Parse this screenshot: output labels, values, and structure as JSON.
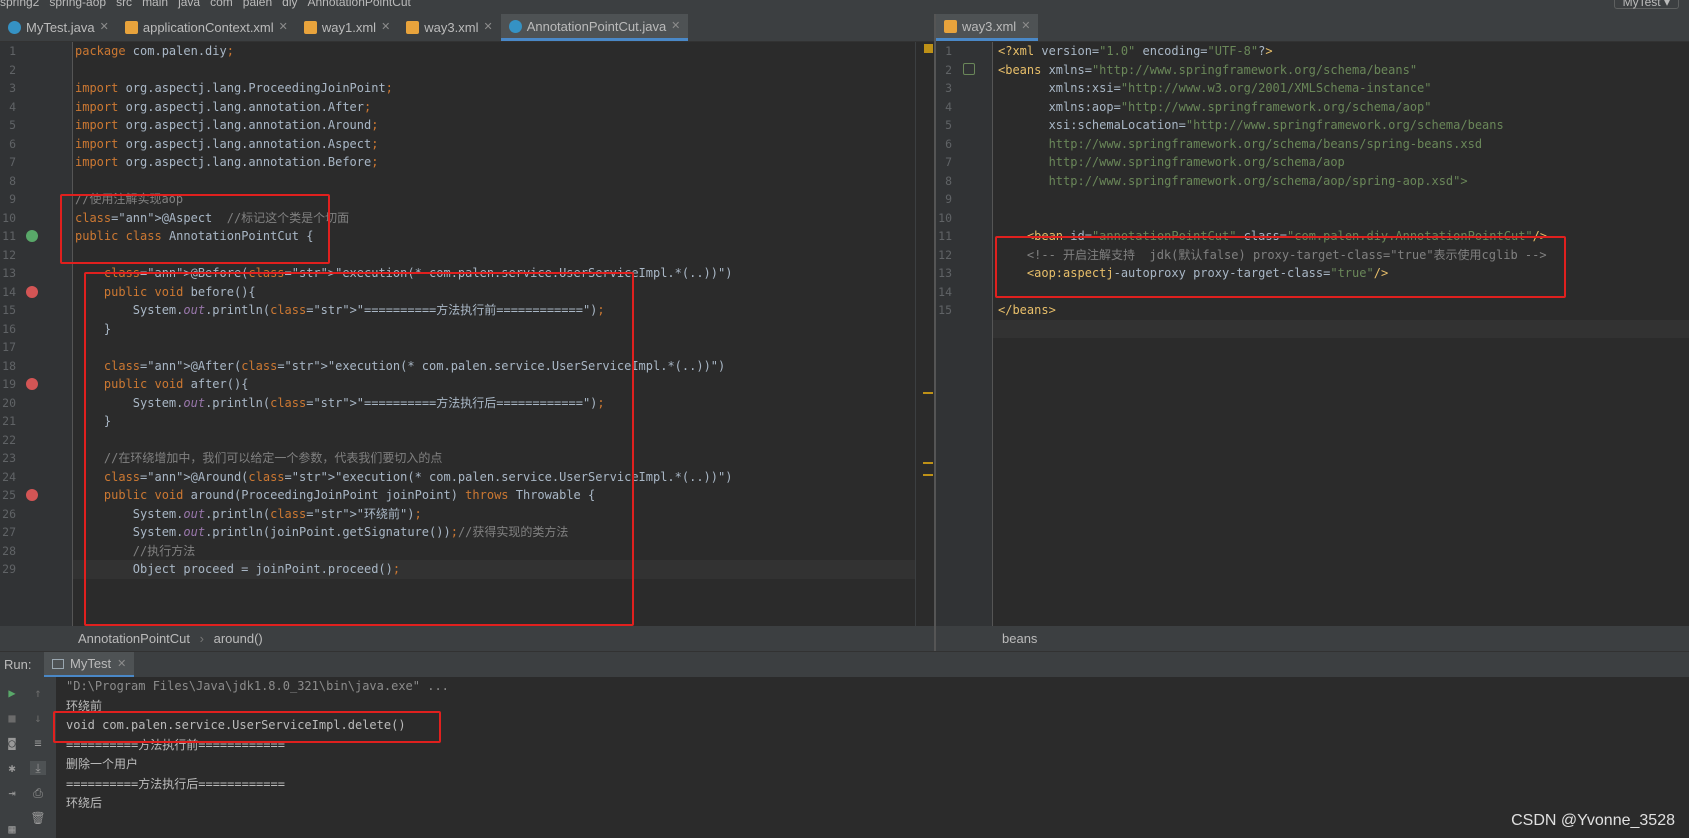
{
  "topbar": {
    "breadcrumb": [
      "spring2",
      "spring-aop",
      "src",
      "main",
      "java",
      "com",
      "palen",
      "diy",
      "AnnotationPointCut"
    ],
    "run_config": "MyTest"
  },
  "left_tabs": [
    {
      "label": "MyTest.java",
      "icon": "java-class-icon",
      "active": false
    },
    {
      "label": "applicationContext.xml",
      "icon": "xml-file-icon",
      "active": false
    },
    {
      "label": "way1.xml",
      "icon": "xml-file-icon",
      "active": false
    },
    {
      "label": "way3.xml",
      "icon": "xml-file-icon",
      "active": false
    },
    {
      "label": "AnnotationPointCut.java",
      "icon": "java-class-icon",
      "active": true
    }
  ],
  "right_tabs": [
    {
      "label": "way3.xml",
      "icon": "xml-file-icon",
      "active": true
    }
  ],
  "java_editor": {
    "line_numbers": [
      "1",
      "2",
      "3",
      "4",
      "5",
      "6",
      "7",
      "8",
      "9",
      "10",
      "11",
      "12",
      "13",
      "14",
      "15",
      "16",
      "17",
      "18",
      "19",
      "20",
      "21",
      "22",
      "23",
      "24",
      "25",
      "26",
      "27",
      "28",
      "29"
    ],
    "current_line": 27,
    "lines": [
      "package com.palen.diy;",
      "",
      "import org.aspectj.lang.ProceedingJoinPoint;",
      "import org.aspectj.lang.annotation.After;",
      "import org.aspectj.lang.annotation.Around;",
      "import org.aspectj.lang.annotation.Aspect;",
      "import org.aspectj.lang.annotation.Before;",
      "",
      "//使用注解实现aop",
      "@Aspect  //标记这个类是个切面",
      "public class AnnotationPointCut {",
      "",
      "    @Before(\"execution(* com.palen.service.UserServiceImpl.*(..))\")",
      "    public void before(){",
      "        System.out.println(\"==========方法执行前============\");",
      "    }",
      "",
      "    @After(\"execution(* com.palen.service.UserServiceImpl.*(..))\")",
      "    public void after(){",
      "        System.out.println(\"==========方法执行后============\");",
      "    }",
      "",
      "    //在环绕增加中，我们可以给定一个参数，代表我们要切入的点",
      "    @Around(\"execution(* com.palen.service.UserServiceImpl.*(..))\")",
      "    public void around(ProceedingJoinPoint joinPoint) throws Throwable {",
      "        System.out.println(\"环绕前\");",
      "        System.out.println(joinPoint.getSignature());//获得实现的类方法",
      "        //执行方法",
      "        Object proceed = joinPoint.proceed();"
    ]
  },
  "xml_editor": {
    "line_numbers": [
      "1",
      "2",
      "3",
      "4",
      "5",
      "6",
      "7",
      "8",
      "9",
      "10",
      "11",
      "12",
      "13",
      "14",
      "15"
    ],
    "current_line": 15,
    "lines": [
      "<?xml version=\"1.0\" encoding=\"UTF-8\"?>",
      "<beans xmlns=\"http://www.springframework.org/schema/beans\"",
      "       xmlns:xsi=\"http://www.w3.org/2001/XMLSchema-instance\"",
      "       xmlns:aop=\"http://www.springframework.org/schema/aop\"",
      "       xsi:schemaLocation=\"http://www.springframework.org/schema/beans",
      "       http://www.springframework.org/schema/beans/spring-beans.xsd",
      "       http://www.springframework.org/schema/aop",
      "       http://www.springframework.org/schema/aop/spring-aop.xsd\">",
      "",
      "",
      "    <bean id=\"annotationPointCut\" class=\"com.palen.diy.AnnotationPointCut\"/>",
      "    <!-- 开启注解支持  jdk(默认false) proxy-target-class=\"true\"表示使用cglib -->",
      "    <aop:aspectj-autoproxy proxy-target-class=\"true\"/>",
      "",
      "</beans>"
    ]
  },
  "left_breadcrumb": [
    "AnnotationPointCut",
    "around()"
  ],
  "right_breadcrumb": [
    "beans"
  ],
  "run_panel": {
    "label": "Run:",
    "tab": "MyTest",
    "output": [
      "\"D:\\Program Files\\Java\\jdk1.8.0_321\\bin\\java.exe\" ...",
      "环绕前",
      "void com.palen.service.UserServiceImpl.delete()",
      "==========方法执行前============",
      "删除一个用户",
      "==========方法执行后============",
      "环绕后"
    ]
  },
  "watermark": "CSDN @Yvonne_3528",
  "colors": {
    "editor_bg": "#2b2b2b",
    "keyword": "#cc7832",
    "string": "#6a8759",
    "annotation": "#bbb529",
    "highlight_box": "#e0201e"
  }
}
